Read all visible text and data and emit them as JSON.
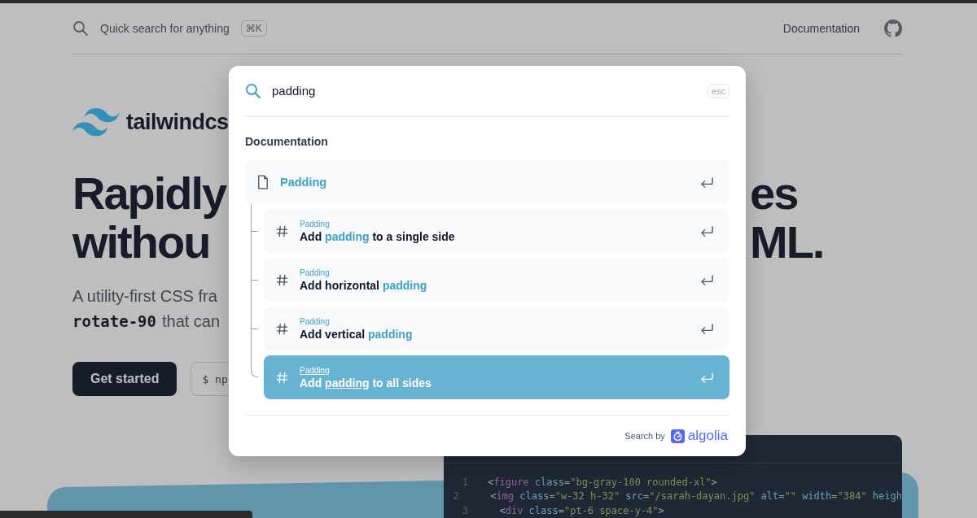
{
  "header": {
    "search_placeholder": "Quick search for anything",
    "shortcut": "⌘K",
    "nav_link": "Documentation"
  },
  "hero": {
    "logo_text": "tailwindcs",
    "headline_lines": [
      "Rapidly",
      "withou"
    ],
    "headline_right_lines": [
      "es",
      "ML."
    ],
    "paragraph_lines": [
      [
        {
          "kind": "text",
          "text": "A utility-first CSS fra"
        }
      ],
      [
        {
          "kind": "code",
          "text": "rotate-90"
        },
        {
          "kind": "text",
          "text": "that can"
        }
      ]
    ],
    "primary_button": "Get started",
    "install_command": "$ np"
  },
  "code": {
    "lines": [
      {
        "number": "1",
        "tokens": [
          {
            "kind": "punct",
            "text": "<"
          },
          {
            "kind": "tag",
            "text": "figure"
          },
          {
            "kind": "attr",
            "text": " class"
          },
          {
            "kind": "punct",
            "text": "="
          },
          {
            "kind": "string",
            "text": "\"bg-gray-100 rounded-xl\""
          },
          {
            "kind": "punct",
            "text": ">"
          }
        ]
      },
      {
        "number": "2",
        "tokens": [
          {
            "kind": "punct",
            "text": "  <"
          },
          {
            "kind": "tag",
            "text": "img"
          },
          {
            "kind": "attr",
            "text": " class"
          },
          {
            "kind": "punct",
            "text": "="
          },
          {
            "kind": "string",
            "text": "\"w-32 h-32\""
          },
          {
            "kind": "attr",
            "text": " src"
          },
          {
            "kind": "punct",
            "text": "="
          },
          {
            "kind": "string",
            "text": "\"/sarah-dayan.jpg\""
          },
          {
            "kind": "attr",
            "text": " alt"
          },
          {
            "kind": "punct",
            "text": "="
          },
          {
            "kind": "string",
            "text": "\"\""
          },
          {
            "kind": "attr",
            "text": " width"
          },
          {
            "kind": "punct",
            "text": "="
          },
          {
            "kind": "string",
            "text": "\"384\""
          },
          {
            "kind": "attr",
            "text": " heigh"
          }
        ]
      },
      {
        "number": "3",
        "tokens": [
          {
            "kind": "punct",
            "text": "  <"
          },
          {
            "kind": "tag",
            "text": "div"
          },
          {
            "kind": "attr",
            "text": " class"
          },
          {
            "kind": "punct",
            "text": "="
          },
          {
            "kind": "string",
            "text": "\"pt-6 space-y-4\""
          },
          {
            "kind": "punct",
            "text": ">"
          }
        ]
      }
    ]
  },
  "search_modal": {
    "query": "padding",
    "close_key": "esc",
    "section_heading": "Documentation",
    "results": [
      {
        "kind": "page",
        "selected": false,
        "title_parts": [
          {
            "text": "Padding",
            "match": true
          }
        ],
        "children": [
          {
            "kind": "section",
            "crumb": "Padding",
            "selected": false,
            "title_parts": [
              {
                "text": "Add ",
                "match": false
              },
              {
                "text": "padding",
                "match": true
              },
              {
                "text": " to a single side",
                "match": false
              }
            ]
          },
          {
            "kind": "section",
            "crumb": "Padding",
            "selected": false,
            "title_parts": [
              {
                "text": "Add horizontal ",
                "match": false
              },
              {
                "text": "padding",
                "match": true
              }
            ]
          },
          {
            "kind": "section",
            "crumb": "Padding",
            "selected": false,
            "title_parts": [
              {
                "text": "Add vertical ",
                "match": false
              },
              {
                "text": "padding",
                "match": true
              }
            ]
          },
          {
            "kind": "section",
            "crumb": "Padding",
            "selected": true,
            "title_parts": [
              {
                "text": "Add ",
                "match": false
              },
              {
                "text": "padding",
                "match": true
              },
              {
                "text": " to all sides",
                "match": false
              }
            ]
          }
        ]
      }
    ],
    "footer_label": "Search by",
    "brand": "algolia"
  }
}
